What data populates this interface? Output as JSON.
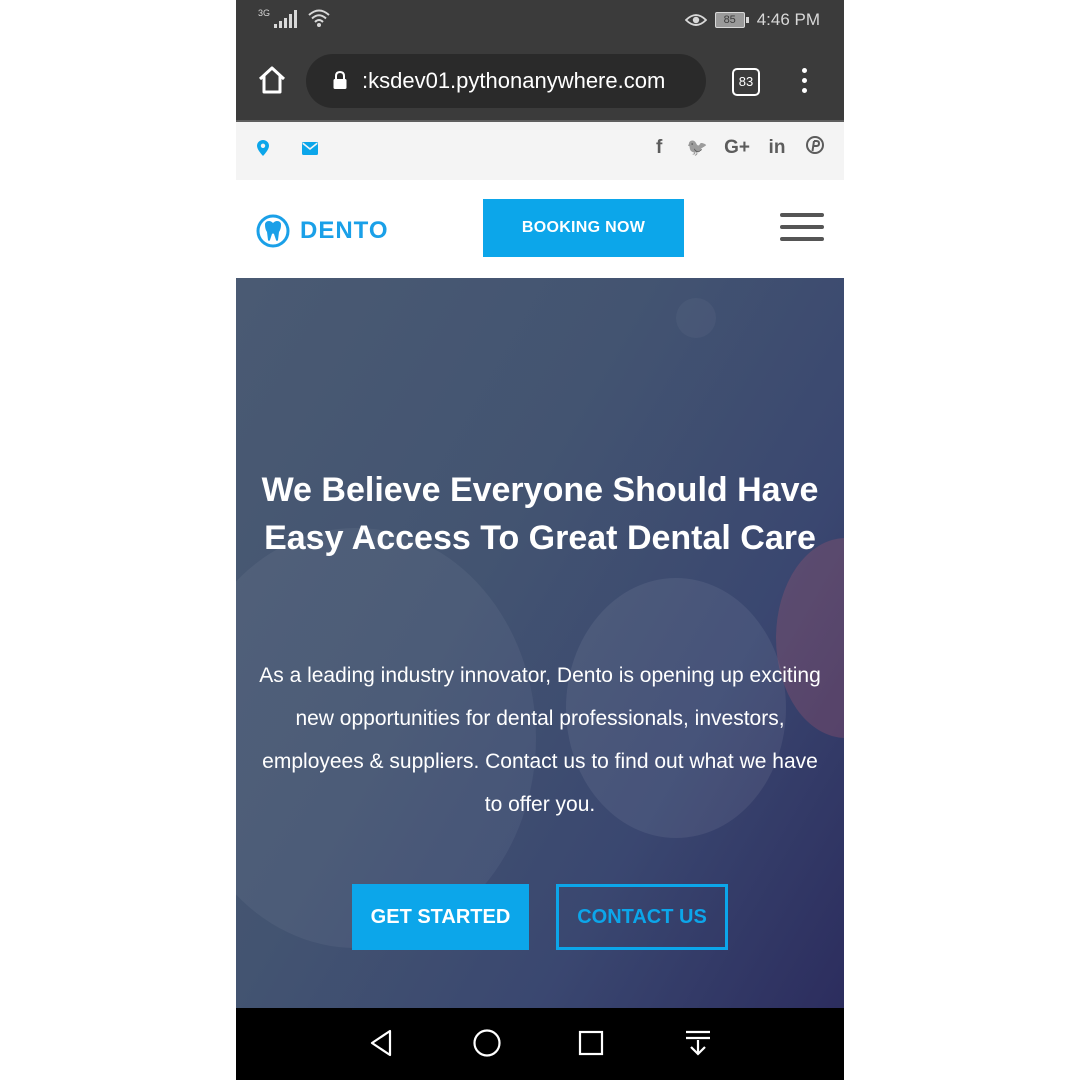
{
  "status_bar": {
    "network": "3G",
    "battery": "85",
    "time": "4:46 PM",
    "icons": [
      "signal-icon",
      "wifi-icon",
      "eye-icon",
      "battery-icon"
    ]
  },
  "browser": {
    "url": ":ksdev01.pythonanywhere.com",
    "tab_count": "83",
    "icons": [
      "home-icon",
      "lock-icon",
      "tabs-icon",
      "menu-icon"
    ]
  },
  "topbar": {
    "left_icons": [
      "location-pin-icon",
      "envelope-icon"
    ],
    "social": {
      "facebook": "f",
      "twitter": "🐦",
      "google_plus": "G+",
      "linkedin": "in",
      "pinterest": "P"
    }
  },
  "header": {
    "logo_text": "DENTO",
    "booking_label": "BOOKING NOW"
  },
  "hero": {
    "title": "We Believe Everyone Should Have Easy Access To Great Dental Care",
    "text": "As a leading industry innovator, Dento is opening up exciting new opportunities for dental professionals, investors, employees & suppliers. Contact us to find out what we have to offer you.",
    "get_started": "GET STARTED",
    "contact_us": "CONTACT US"
  },
  "nav_bar": {
    "icons": [
      "back-icon",
      "home-circle-icon",
      "recents-icon",
      "notification-pull-icon"
    ]
  },
  "colors": {
    "accent": "#0ca6ea",
    "chrome": "#3b3b3b",
    "hero_overlay": "#3a4770"
  }
}
